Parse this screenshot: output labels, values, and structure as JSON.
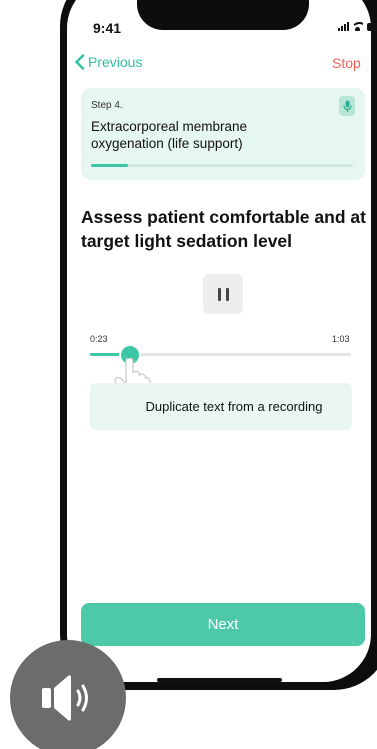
{
  "status_bar": {
    "time": "9:41"
  },
  "nav": {
    "previous_label": "Previous",
    "stop_label": "Stop"
  },
  "step": {
    "number_label": "Step 4.",
    "title": "Extracorporeal membrane oxygenation (life support)",
    "progress": 0.14
  },
  "instruction": "Assess patient comfortable and at target light sedation level",
  "player": {
    "current_time": "0:23",
    "total_time": "1:03",
    "progress": 0.15,
    "state": "playing"
  },
  "duplicate_text_label": "Duplicate text from a recording",
  "next_label": "Next",
  "colors": {
    "accent": "#3ec7a7",
    "stop": "#f0605a",
    "card_bg": "#e6f6f1",
    "next_button": "#4dc9a9"
  },
  "icons": [
    "chevron-left-icon",
    "microphone-icon",
    "pause-icon",
    "hand-pointer-icon",
    "speaker-icon",
    "signal-icon",
    "wifi-icon",
    "battery-icon"
  ]
}
